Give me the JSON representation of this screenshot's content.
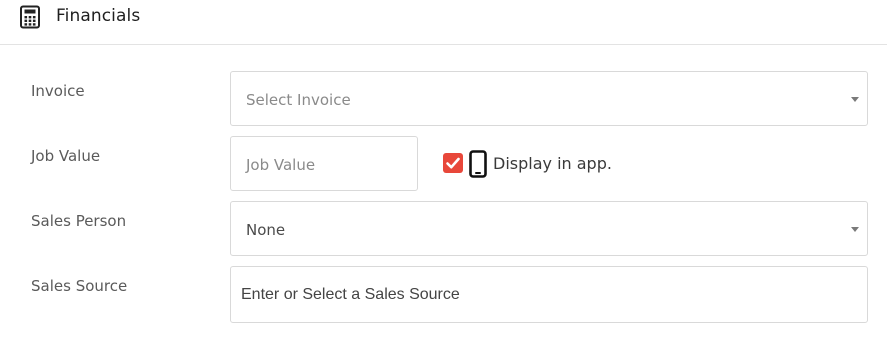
{
  "header": {
    "title": "Financials",
    "icon": "calculator-icon"
  },
  "invoice": {
    "label": "Invoice",
    "placeholder": "Select Invoice"
  },
  "job_value": {
    "label": "Job Value",
    "placeholder": "Job Value",
    "display_in_app_label": "Display in app.",
    "display_in_app_checked": true,
    "checkbox_color": "#e8473a",
    "phone_icon": "mobile-phone-icon"
  },
  "sales_person": {
    "label": "Sales Person",
    "selected": "None"
  },
  "sales_source": {
    "label": "Sales Source",
    "placeholder": "Enter or Select a Sales Source"
  }
}
